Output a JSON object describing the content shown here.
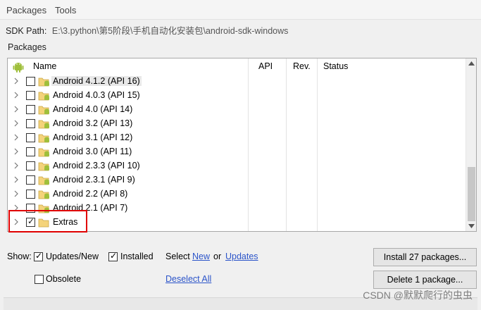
{
  "menu": {
    "packages": "Packages",
    "tools": "Tools"
  },
  "sdk": {
    "label": "SDK Path:",
    "value": "E:\\3.python\\第5阶段\\手机自动化安装包\\android-sdk-windows"
  },
  "packages_group_label": "Packages",
  "table": {
    "headers": {
      "name": "Name",
      "api": "API",
      "rev": "Rev.",
      "status": "Status"
    },
    "rows": [
      {
        "label": "Android 4.1.2 (API 16)",
        "checked": false,
        "icon": "android-folder-icon"
      },
      {
        "label": "Android 4.0.3 (API 15)",
        "checked": false,
        "icon": "android-folder-icon"
      },
      {
        "label": "Android 4.0 (API 14)",
        "checked": false,
        "icon": "android-folder-icon"
      },
      {
        "label": "Android 3.2 (API 13)",
        "checked": false,
        "icon": "android-folder-icon"
      },
      {
        "label": "Android 3.1 (API 12)",
        "checked": false,
        "icon": "android-folder-icon"
      },
      {
        "label": "Android 3.0 (API 11)",
        "checked": false,
        "icon": "android-folder-icon"
      },
      {
        "label": "Android 2.3.3 (API 10)",
        "checked": false,
        "icon": "android-folder-icon"
      },
      {
        "label": "Android 2.3.1 (API 9)",
        "checked": false,
        "icon": "android-folder-icon"
      },
      {
        "label": "Android 2.2 (API 8)",
        "checked": false,
        "icon": "android-folder-icon"
      },
      {
        "label": "Android 2.1 (API 7)",
        "checked": false,
        "icon": "android-folder-icon"
      },
      {
        "label": "Extras",
        "checked": true,
        "icon": "folder-icon"
      }
    ]
  },
  "show": {
    "label": "Show:",
    "updates_new": "Updates/New",
    "updates_new_checked": true,
    "installed": "Installed",
    "installed_checked": true,
    "select_label": "Select",
    "new_link": "New",
    "or": "or",
    "updates_link": "Updates"
  },
  "obsolete": {
    "label": "Obsolete",
    "checked": false,
    "deselect_all": "Deselect All"
  },
  "buttons": {
    "install": "Install 27 packages...",
    "delete": "Delete 1 package..."
  },
  "watermark": "CSDN @默默爬行的虫虫",
  "colors": {
    "android_green": "#9fbf3b",
    "folder_yellow": "#f4d37a",
    "link_blue": "#2b54c9",
    "highlight_red": "#e00000"
  }
}
